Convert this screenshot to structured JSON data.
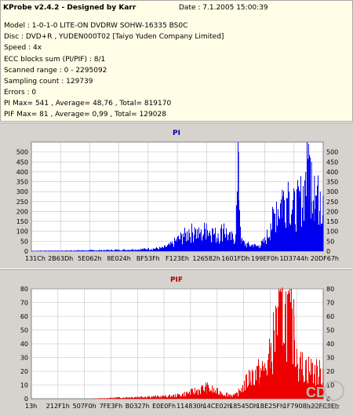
{
  "info": {
    "title": "KProbe v2.4.2 - Designed by Karr",
    "date": "Date : 7.1.2005 15:00:39",
    "lines": [
      "Model : 1-0-1-0 LITE-ON DVDRW SOHW-16335 BS0C",
      "Disc : DVD+R , YUDEN000T02 [Taiyo Yuden Company Limited]",
      "Speed : 4x",
      "ECC blocks sum (PI/PIF) : 8/1",
      "Scanned range : 0 - 2295092",
      "Sampling count : 129739",
      "Errors : 0",
      "PI Max= 541 , Average= 48,76 , Total= 819170",
      "PIF Max= 81 , Average= 0,99 , Total= 129028"
    ]
  },
  "watermark": {
    "line1": "CD",
    "line2": "www.cdr.cz"
  },
  "colors": {
    "pi": "#0000ee",
    "pif": "#ee0000",
    "plot_bg": "#ffffff",
    "panel_bg": "#d6d3ce",
    "info_bg": "#fffde6",
    "grid": "#c0c0c0"
  },
  "chart_data": [
    {
      "type": "area",
      "title": "PI",
      "ylim": [
        0,
        550
      ],
      "yticks": [
        0,
        50,
        100,
        150,
        200,
        250,
        300,
        350,
        400,
        450,
        500
      ],
      "xticklabels": [
        "131Ch",
        "2B63Dh",
        "5E062h",
        "8E024h",
        "BF53Fh",
        "F123Eh",
        "126582h",
        "1601FDh",
        "199EF0h",
        "1D3744h",
        "20DF67h"
      ],
      "grid": true,
      "x": [
        0.0,
        0.05,
        0.1,
        0.15,
        0.2,
        0.25,
        0.3,
        0.35,
        0.4,
        0.45,
        0.48,
        0.5,
        0.52,
        0.54,
        0.56,
        0.58,
        0.6,
        0.62,
        0.64,
        0.66,
        0.68,
        0.7,
        0.71,
        0.72,
        0.74,
        0.76,
        0.78,
        0.8,
        0.82,
        0.84,
        0.86,
        0.88,
        0.9,
        0.92,
        0.94,
        0.95,
        0.96,
        0.97,
        0.98,
        0.99,
        1.0
      ],
      "values": [
        2,
        3,
        3,
        4,
        5,
        6,
        8,
        10,
        14,
        20,
        40,
        70,
        90,
        110,
        120,
        95,
        140,
        115,
        90,
        140,
        80,
        85,
        500,
        60,
        40,
        35,
        30,
        60,
        140,
        250,
        310,
        350,
        260,
        300,
        400,
        541,
        450,
        380,
        330,
        300,
        280
      ]
    },
    {
      "type": "area",
      "title": "PIF",
      "ylim": [
        0,
        80
      ],
      "yticks": [
        0,
        10,
        20,
        30,
        40,
        50,
        60,
        70,
        80
      ],
      "xticklabels": [
        "13h",
        "212F1h",
        "507F0h",
        "7FE3Fh",
        "B0327h",
        "E0E0Fh",
        "114830h",
        "14CE02h",
        "18545Dh",
        "1BE25Fh",
        "1F7908h",
        "22FC3Eh"
      ],
      "grid": true,
      "x": [
        0.0,
        0.1,
        0.2,
        0.3,
        0.4,
        0.45,
        0.5,
        0.55,
        0.6,
        0.65,
        0.7,
        0.72,
        0.75,
        0.78,
        0.8,
        0.82,
        0.84,
        0.86,
        0.88,
        0.9,
        0.92,
        0.94,
        0.96,
        0.98,
        1.0
      ],
      "values": [
        0,
        0,
        0,
        1,
        2,
        2,
        3,
        6,
        10,
        5,
        3,
        8,
        20,
        24,
        26,
        38,
        66,
        81,
        75,
        60,
        30,
        28,
        26,
        24,
        22
      ]
    }
  ]
}
